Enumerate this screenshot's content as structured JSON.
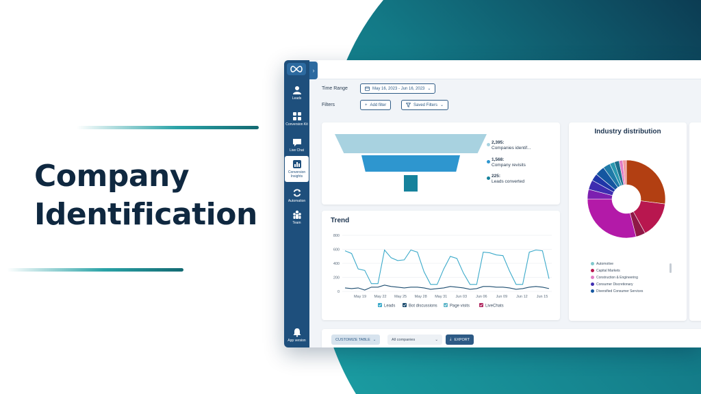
{
  "hero": {
    "line1": "Company",
    "line2": "Identification"
  },
  "colors": {
    "teal_dark": "#0e4f5e",
    "teal_light": "#1fa0a4",
    "navy": "#1e4f7c",
    "brand_text": "#0f2840"
  },
  "sidebar": {
    "items": [
      {
        "label": "Leads",
        "icon": "lead-user-icon"
      },
      {
        "label": "Conversion Kit",
        "icon": "conversion-kit-icon"
      },
      {
        "label": "Live Chat",
        "icon": "live-chat-icon"
      },
      {
        "label": "Conversion Insights",
        "icon": "bar-chart-icon",
        "active": true
      },
      {
        "label": "Automation",
        "icon": "refresh-icon"
      },
      {
        "label": "Team",
        "icon": "team-icon"
      }
    ],
    "bottom": {
      "label": "App version",
      "icon": "bell-icon"
    }
  },
  "filters": {
    "time_range_label": "Time Range",
    "date_range": "May 16, 2023 - Jun 16, 2023",
    "filters_label": "Filters",
    "add_filter": "Add filter",
    "saved_filters": "Saved Filters"
  },
  "funnel": {
    "stages": [
      {
        "value": "2,395:",
        "label": "Companies identif...",
        "color": "#a8d2e0"
      },
      {
        "value": "1,568:",
        "label": "Company revisits",
        "color": "#2e96cf"
      },
      {
        "value": "225:",
        "label": "Leads converted",
        "color": "#16829c"
      }
    ]
  },
  "chart_data": [
    {
      "type": "line",
      "title": "Trend",
      "ylim": [
        0,
        800
      ],
      "yticks": [
        0,
        200,
        400,
        600,
        800
      ],
      "xtick_labels": [
        "May 19",
        "May 22",
        "May 25",
        "May 28",
        "May 31",
        "Jun 03",
        "Jun 06",
        "Jun 09",
        "Jun 12",
        "Jun 15"
      ],
      "grid": true,
      "legend_position": "bottom",
      "series": [
        {
          "name": "Leads",
          "color": "#3aa9c9",
          "values": [
            580,
            540,
            320,
            300,
            110,
            110,
            590,
            480,
            440,
            450,
            590,
            560,
            280,
            100,
            100,
            320,
            500,
            470,
            260,
            100,
            100,
            560,
            550,
            520,
            510,
            290,
            100,
            100,
            560,
            590,
            580,
            180
          ]
        },
        {
          "name": "Bot discussions",
          "color": "#1c4c6f",
          "values": [
            50,
            40,
            50,
            20,
            60,
            60,
            90,
            70,
            60,
            50,
            60,
            60,
            50,
            30,
            40,
            50,
            70,
            60,
            50,
            30,
            40,
            70,
            70,
            60,
            60,
            50,
            30,
            40,
            60,
            70,
            60,
            40
          ]
        },
        {
          "name": "Page visits",
          "color": "#5fb6c9",
          "values": []
        },
        {
          "name": "LiveChats",
          "color": "#b0275f",
          "values": []
        }
      ]
    },
    {
      "type": "pie",
      "title": "Industry distribution",
      "slices": [
        {
          "label": "",
          "value": 27.0,
          "color": "#b23f12"
        },
        {
          "label": "",
          "value": 15.0,
          "color": "#b8174f"
        },
        {
          "label": "",
          "value": 4.0,
          "color": "#8f1846"
        },
        {
          "label": "",
          "value": 29.0,
          "color": "#b31aa8"
        },
        {
          "label": "",
          "value": 4.0,
          "color": "#7c1fb0"
        },
        {
          "label": "",
          "value": 4.0,
          "color": "#3e2db0"
        },
        {
          "label": "",
          "value": 3.0,
          "color": "#1f36a8"
        },
        {
          "label": "",
          "value": 4.0,
          "color": "#1456a0"
        },
        {
          "label": "",
          "value": 3.0,
          "color": "#1f7aa8"
        },
        {
          "label": "",
          "value": 2.0,
          "color": "#2a98b0"
        },
        {
          "label": "",
          "value": 2.0,
          "color": "#1b6e8c"
        },
        {
          "label": "",
          "value": 1.5,
          "color": "#e07dc4"
        },
        {
          "label": "",
          "value": 1.5,
          "color": "#f29aa0"
        }
      ],
      "legend": [
        {
          "label": "Automotive",
          "color": "#7fc8cc"
        },
        {
          "label": "Capital Markets",
          "color": "#b8174f"
        },
        {
          "label": "Construction & Engineering",
          "color": "#e07dc4"
        },
        {
          "label": "Consumer Discretionary",
          "color": "#3e2db0"
        },
        {
          "label": "Diversified Consumer Services",
          "color": "#1456a0"
        }
      ]
    }
  ],
  "table": {
    "customize": "CUSTOMIZE TABLE",
    "companies": "All companies",
    "export": "EXPORT"
  }
}
